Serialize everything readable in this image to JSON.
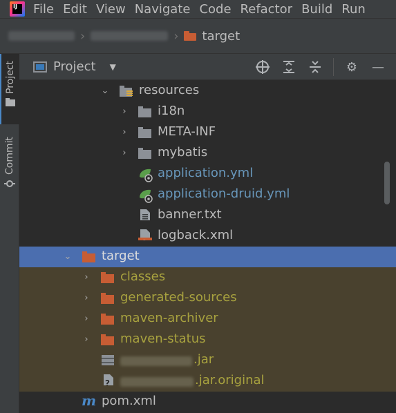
{
  "menubar": {
    "items": [
      "File",
      "Edit",
      "View",
      "Navigate",
      "Code",
      "Refactor",
      "Build",
      "Run"
    ]
  },
  "breadcrumb": {
    "current": "target"
  },
  "toolwindow": {
    "title": "Project"
  },
  "sidebar": {
    "tabs": [
      {
        "label": "Project"
      },
      {
        "label": "Commit"
      }
    ]
  },
  "tree": {
    "rows": [
      {
        "label": "resources",
        "type": "resources-folder",
        "expanded": true
      },
      {
        "label": "i18n",
        "type": "folder",
        "expanded": false
      },
      {
        "label": "META-INF",
        "type": "folder",
        "expanded": false
      },
      {
        "label": "mybatis",
        "type": "folder",
        "expanded": false
      },
      {
        "label": "application.yml",
        "type": "yml-file"
      },
      {
        "label": "application-druid.yml",
        "type": "yml-file"
      },
      {
        "label": "banner.txt",
        "type": "text-file"
      },
      {
        "label": "logback.xml",
        "type": "xml-file"
      },
      {
        "label": "target",
        "type": "excluded-folder",
        "expanded": true,
        "selected": true
      },
      {
        "label": "classes",
        "type": "excluded-folder",
        "expanded": false
      },
      {
        "label": "generated-sources",
        "type": "excluded-folder",
        "expanded": false
      },
      {
        "label": "maven-archiver",
        "type": "excluded-folder",
        "expanded": false
      },
      {
        "label": "maven-status",
        "type": "excluded-folder",
        "expanded": false
      },
      {
        "label": ".jar",
        "type": "jar-file"
      },
      {
        "label": ".jar.original",
        "type": "unknown-file"
      },
      {
        "label": "pom.xml",
        "type": "maven-file"
      }
    ]
  },
  "colors": {
    "selection": "#4b6eaf",
    "excluded_bg": "#49412e",
    "excluded_text": "#a8a23f",
    "modified_text": "#6897bb",
    "excluded_folder": "#c75d34"
  }
}
